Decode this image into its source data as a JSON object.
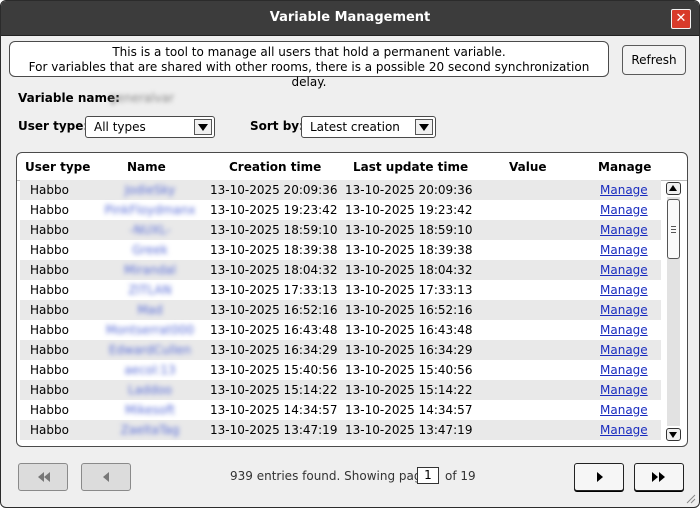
{
  "window": {
    "title": "Variable Management",
    "close_glyph": "✕"
  },
  "info": {
    "line1": "This is a tool to manage all users that hold a permanent variable.",
    "line2": "For variables that are shared with other rooms, there is a possible 20 second synchronization delay."
  },
  "refresh_label": "Refresh",
  "variable": {
    "label": "Variable name:",
    "value": "generalvar"
  },
  "filters": {
    "user_type_label": "User type:",
    "user_type_value": "All types",
    "sort_by_label": "Sort by:",
    "sort_by_value": "Latest creation"
  },
  "table": {
    "headers": [
      "User type",
      "Name",
      "Creation time",
      "Last update time",
      "Value",
      "Manage"
    ],
    "rows": [
      {
        "type": "Habbo",
        "name": "JodieSky",
        "created": "13-10-2025 20:09:36",
        "updated": "13-10-2025 20:09:36",
        "value": "",
        "manage": "Manage"
      },
      {
        "type": "Habbo",
        "name": "PinkFloydmanx",
        "created": "13-10-2025 19:23:42",
        "updated": "13-10-2025 19:23:42",
        "value": "",
        "manage": "Manage"
      },
      {
        "type": "Habbo",
        "name": "-NUXL-",
        "created": "13-10-2025 18:59:10",
        "updated": "13-10-2025 18:59:10",
        "value": "",
        "manage": "Manage"
      },
      {
        "type": "Habbo",
        "name": "Greek",
        "created": "13-10-2025 18:39:38",
        "updated": "13-10-2025 18:39:38",
        "value": "",
        "manage": "Manage"
      },
      {
        "type": "Habbo",
        "name": "Mirandal",
        "created": "13-10-2025 18:04:32",
        "updated": "13-10-2025 18:04:32",
        "value": "",
        "manage": "Manage"
      },
      {
        "type": "Habbo",
        "name": "ZITLAN",
        "created": "13-10-2025 17:33:13",
        "updated": "13-10-2025 17:33:13",
        "value": "",
        "manage": "Manage"
      },
      {
        "type": "Habbo",
        "name": "Mad",
        "created": "13-10-2025 16:52:16",
        "updated": "13-10-2025 16:52:16",
        "value": "",
        "manage": "Manage"
      },
      {
        "type": "Habbo",
        "name": "Montserrat000",
        "created": "13-10-2025 16:43:48",
        "updated": "13-10-2025 16:43:48",
        "value": "",
        "manage": "Manage"
      },
      {
        "type": "Habbo",
        "name": "EdwardCullen",
        "created": "13-10-2025 16:34:29",
        "updated": "13-10-2025 16:34:29",
        "value": "",
        "manage": "Manage"
      },
      {
        "type": "Habbo",
        "name": "aecol:13",
        "created": "13-10-2025 15:40:56",
        "updated": "13-10-2025 15:40:56",
        "value": "",
        "manage": "Manage"
      },
      {
        "type": "Habbo",
        "name": "Laddoo",
        "created": "13-10-2025 15:14:22",
        "updated": "13-10-2025 15:14:22",
        "value": "",
        "manage": "Manage"
      },
      {
        "type": "Habbo",
        "name": "Mikesoft",
        "created": "13-10-2025 14:34:57",
        "updated": "13-10-2025 14:34:57",
        "value": "",
        "manage": "Manage"
      },
      {
        "type": "Habbo",
        "name": "ZaeltaTag",
        "created": "13-10-2025 13:47:19",
        "updated": "13-10-2025 13:47:19",
        "value": "",
        "manage": "Manage"
      }
    ]
  },
  "pager": {
    "entries_text": "939 entries found. Showing page",
    "current_page": "1",
    "of_text": "of 19",
    "first_glyph": "◀◀",
    "prev_glyph": "◀",
    "next_glyph": "▶",
    "last_glyph": "▶▶"
  }
}
